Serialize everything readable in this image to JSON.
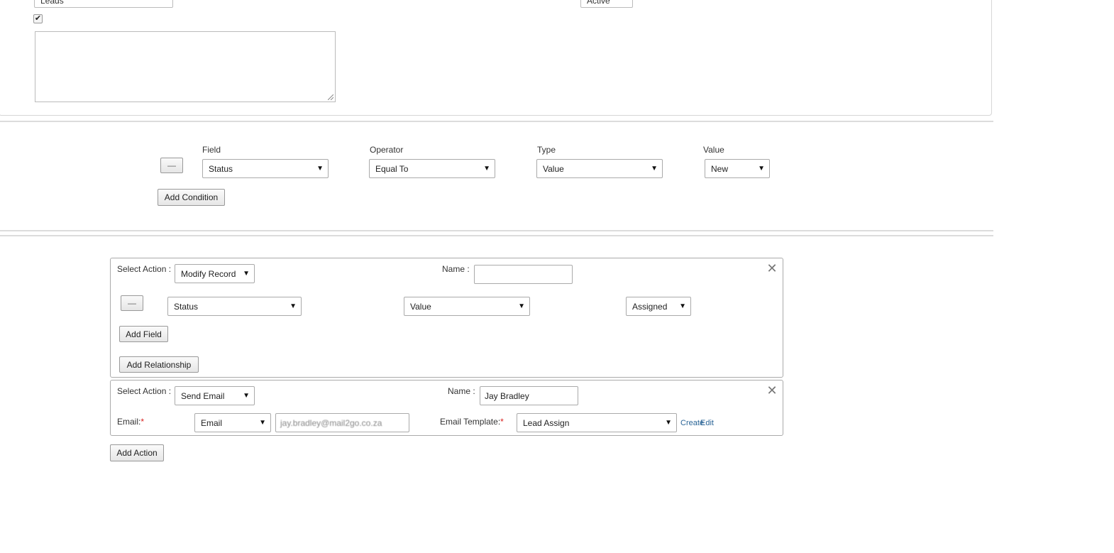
{
  "top": {
    "module_value": "Leads",
    "status_value": "Active",
    "checkbox_glyph": "✔"
  },
  "conditions": {
    "headers": {
      "field": "Field",
      "operator": "Operator",
      "type": "Type",
      "value": "Value"
    },
    "row": {
      "remove_label": "—",
      "field": "Status",
      "operator": "Equal To",
      "type": "Value",
      "value": "New"
    },
    "add_label": "Add Condition"
  },
  "actions": [
    {
      "select_action_label": "Select Action :",
      "action": "Modify Record",
      "name_label": "Name :",
      "name_value": "",
      "close_glyph": "✕",
      "field_row": {
        "remove_label": "—",
        "field": "Status",
        "type": "Value",
        "value": "Assigned"
      },
      "add_field_label": "Add Field",
      "add_relationship_label": "Add Relationship"
    },
    {
      "select_action_label": "Select Action :",
      "action": "Send Email",
      "name_label": "Name :",
      "name_value": "Jay Bradley",
      "close_glyph": "✕",
      "email_label": "Email:",
      "email_type": "Email",
      "email_address": "jay.bradley@mail2go.co.za",
      "template_label": "Email Template:",
      "template_value": "Lead Assign",
      "create_label": "Create",
      "edit_label": "Edit",
      "required_mark": "*"
    }
  ],
  "add_action_label": "Add Action",
  "dropdown_arrow": "▼"
}
